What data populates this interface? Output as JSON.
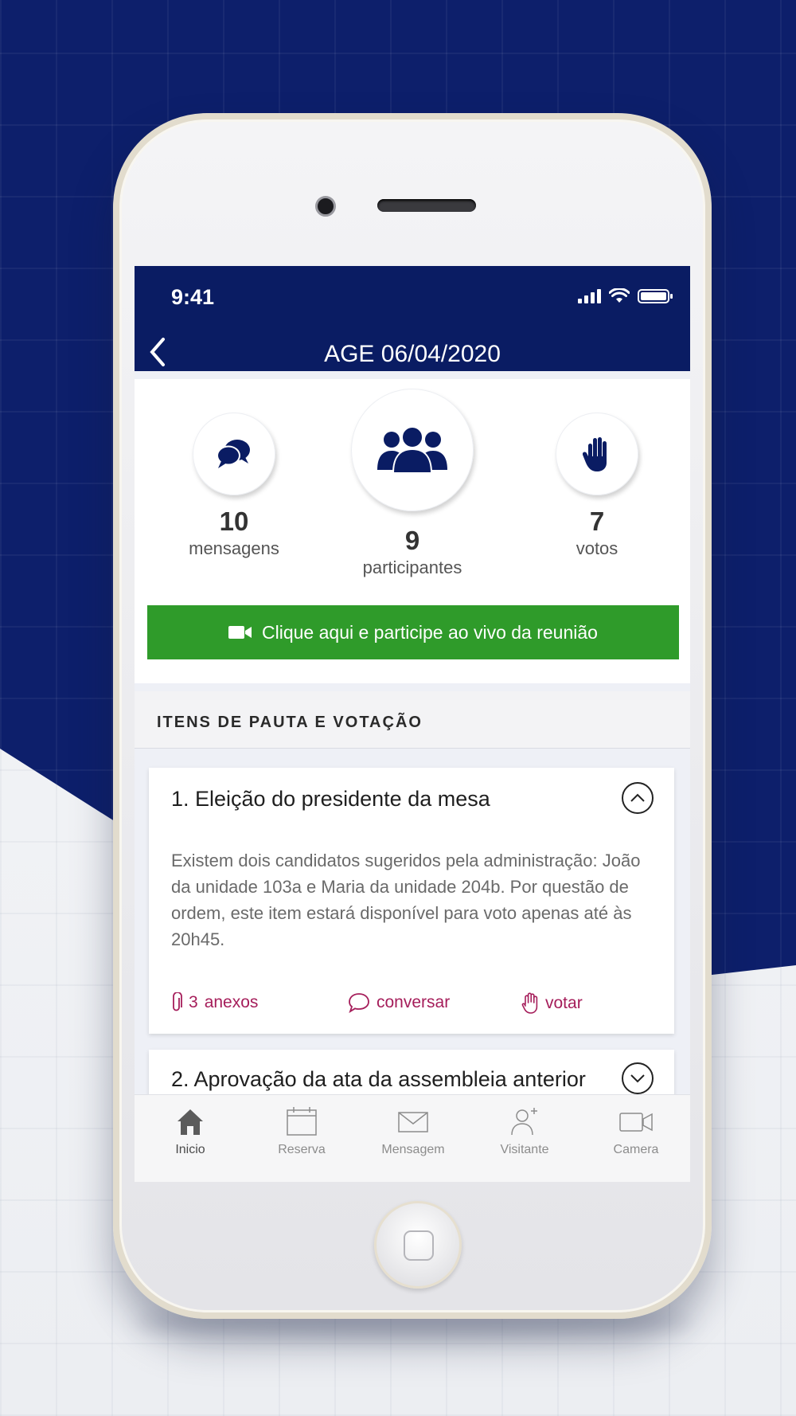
{
  "status_bar": {
    "time": "9:41"
  },
  "nav": {
    "title": "AGE 06/04/2020"
  },
  "stats": {
    "messages": {
      "count": "10",
      "label": "mensagens",
      "icon": "chat-bubbles-icon"
    },
    "participants": {
      "count": "9",
      "label": "participantes",
      "icon": "group-people-icon"
    },
    "votes": {
      "count": "7",
      "label": "votos",
      "icon": "raised-hand-icon"
    }
  },
  "live_button": {
    "label": "Clique aqui e participe ao vivo da reunião",
    "icon": "video-camera-icon"
  },
  "section": {
    "title": "ITENS DE PAUTA E VOTAÇÃO"
  },
  "items": [
    {
      "title": "1. Eleição do presidente da mesa",
      "description": "Existem dois candidatos sugeridos pela administração: João da unidade 103a e Maria da unidade 204b. Por questão de ordem, este item estará disponível para voto apenas até às 20h45.",
      "expanded": true,
      "actions": {
        "attachments_count": "3",
        "attachments_label": "anexos",
        "chat_label": "conversar",
        "vote_label": "votar"
      }
    },
    {
      "title": "2. Aprovação da ata da assembleia anterior",
      "expanded": false
    }
  ],
  "tabbar": [
    {
      "label": "Inicio",
      "icon": "home-icon",
      "active": true
    },
    {
      "label": "Reserva",
      "icon": "calendar-icon",
      "active": false
    },
    {
      "label": "Mensagem",
      "icon": "envelope-icon",
      "active": false
    },
    {
      "label": "Visitante",
      "icon": "visitor-icon",
      "active": false
    },
    {
      "label": "Camera",
      "icon": "camera-icon",
      "active": false
    }
  ],
  "colors": {
    "navy": "#0a1c63",
    "live_green": "#2f9b2a",
    "action_magenta": "#a51d5a"
  }
}
